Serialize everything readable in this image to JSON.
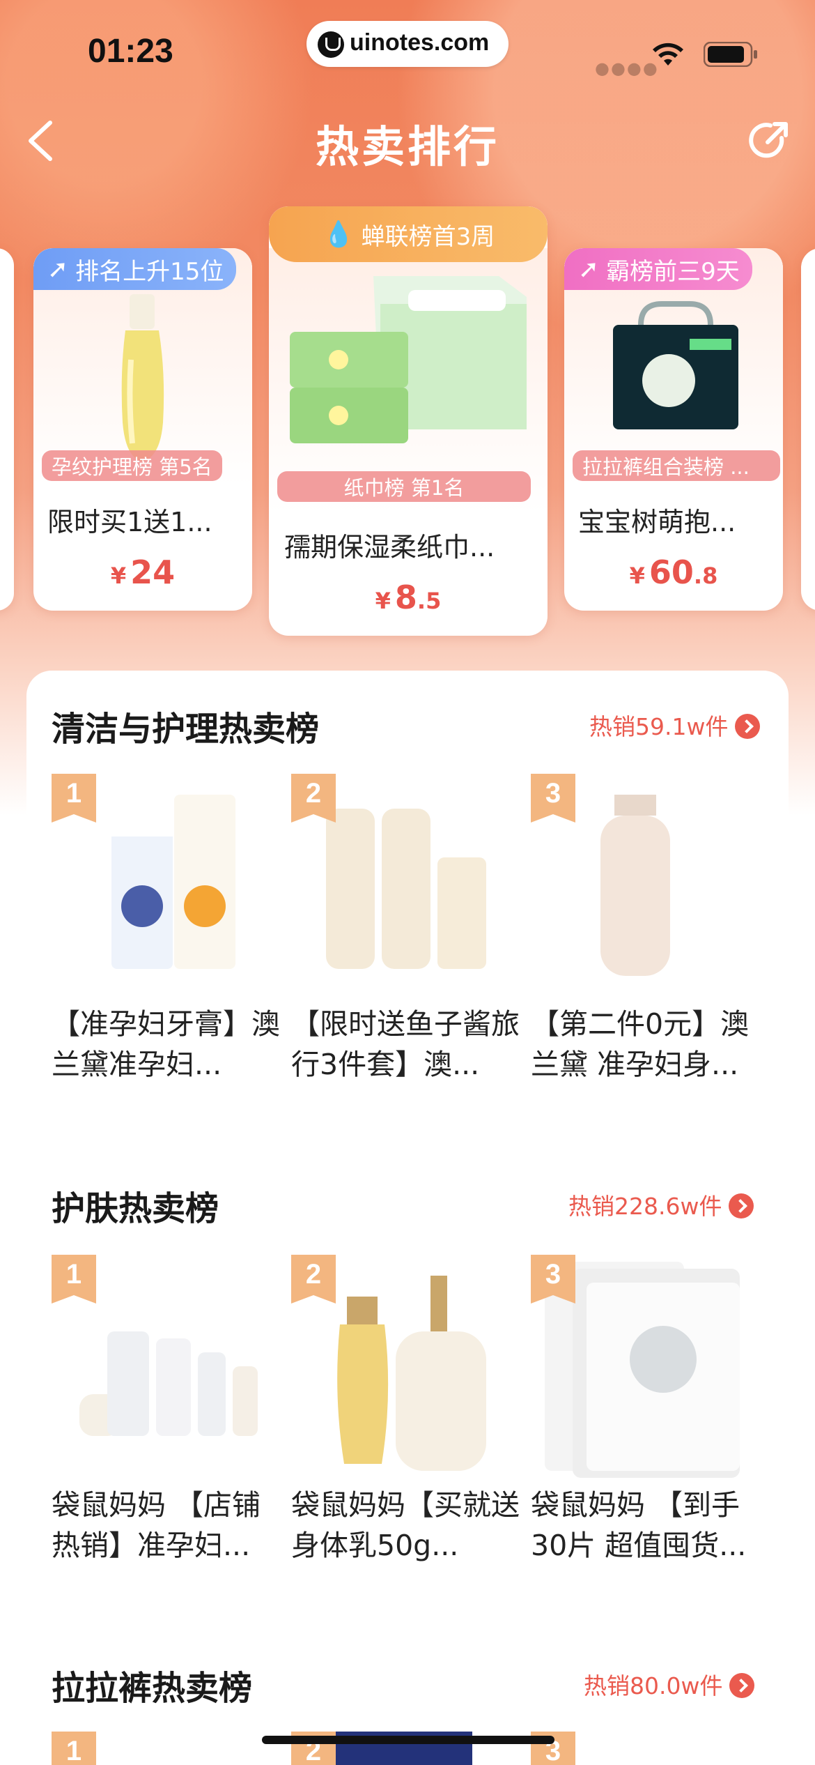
{
  "status": {
    "time": "01:23",
    "url": "uinotes.com"
  },
  "nav": {
    "title": "热卖排行"
  },
  "carousel": [
    {
      "badge": "排名上升15位",
      "rank_label": "孕纹护理榜 第5名",
      "name": "限时买1送1...",
      "price_int": "24",
      "price_dec": "",
      "currency": "¥"
    },
    {
      "badge": "蝉联榜首3周",
      "rank_label": "纸巾榜 第1名",
      "name": "孺期保湿柔纸巾...",
      "price_int": "8",
      "price_dec": ".5",
      "currency": "¥"
    },
    {
      "badge": "霸榜前三9天",
      "rank_label": "拉拉裤组合装榜 ...",
      "name": "宝宝树萌抱...",
      "price_int": "60",
      "price_dec": ".8",
      "currency": "¥"
    }
  ],
  "sections": [
    {
      "title": "清洁与护理热卖榜",
      "sales": "热销59.1w件",
      "products": [
        {
          "rank": "1",
          "title": "【准孕妇牙膏】澳兰黛准孕妇..."
        },
        {
          "rank": "2",
          "title": "【限时送鱼子酱旅行3件套】澳..."
        },
        {
          "rank": "3",
          "title": "【第二件0元】澳兰黛 准孕妇身..."
        }
      ]
    },
    {
      "title": "护肤热卖榜",
      "sales": "热销228.6w件",
      "products": [
        {
          "rank": "1",
          "title": "袋鼠妈妈 【店铺热销】准孕妇..."
        },
        {
          "rank": "2",
          "title": "袋鼠妈妈【买就送身体乳50g..."
        },
        {
          "rank": "3",
          "title": "袋鼠妈妈 【到手30片 超值囤货..."
        }
      ]
    },
    {
      "title": "拉拉裤热卖榜",
      "sales": "热销80.0w件",
      "products": [
        {
          "rank": "1",
          "title": ""
        },
        {
          "rank": "2",
          "title": ""
        },
        {
          "rank": "3",
          "title": ""
        }
      ]
    }
  ],
  "colors": {
    "accent": "#ea5a4e",
    "header_bg": "#f07d56",
    "rank_gold": "#f3b680"
  }
}
